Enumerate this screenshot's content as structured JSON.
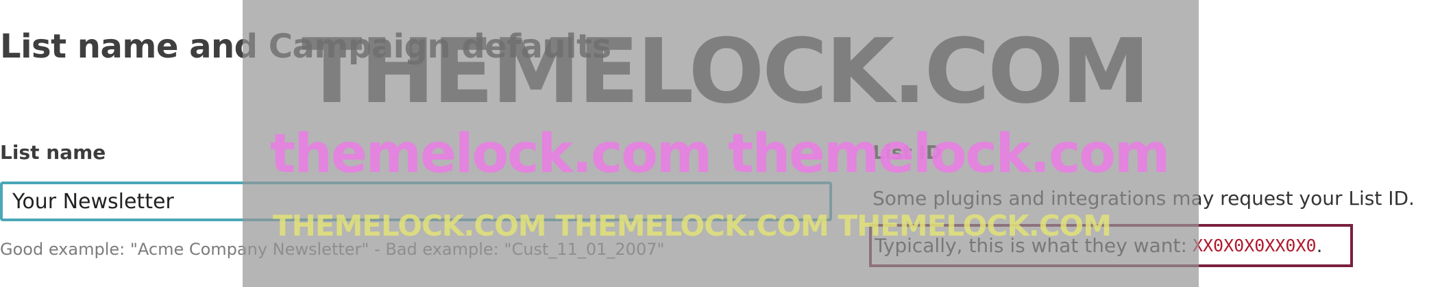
{
  "page": {
    "title": "List name and Campaign defaults"
  },
  "list_name": {
    "label": "List name",
    "value": "Your Newsletter",
    "hint": "Good example: \"Acme Company Newsletter\" - Bad example: \"Cust_11_01_2007\""
  },
  "list_id": {
    "label": "List ID",
    "description": "Some plugins and integrations may request your List ID.",
    "callout_prefix": "Typically, this is what they want:",
    "id_value": "XX0X0X0XX0X0",
    "callout_suffix": "."
  },
  "watermark": {
    "line1": "THEMELOCK.COM",
    "line2": "themelock.com themelock.com",
    "line3": "THEMELOCK.COM THEMELOCK.COM THEMELOCK.COM"
  },
  "colors": {
    "input_border": "#4aa7b7",
    "callout_border": "#7a1f3e",
    "id_text": "#b0172b"
  }
}
